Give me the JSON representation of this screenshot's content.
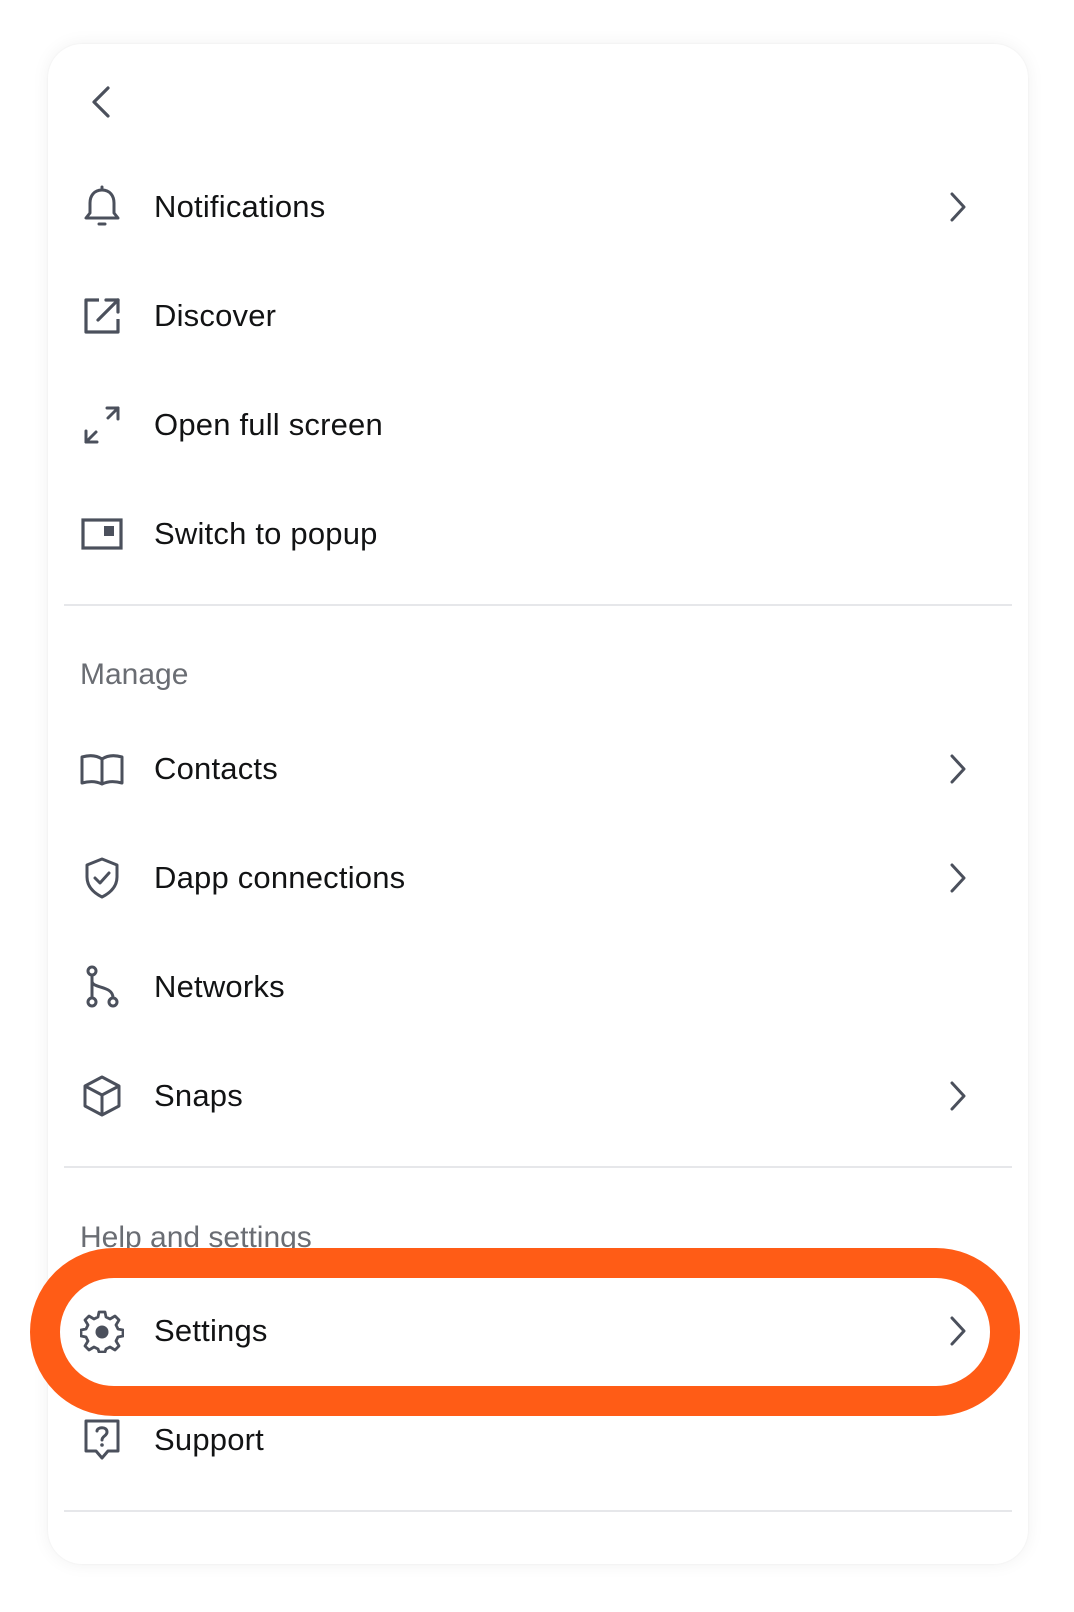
{
  "menu": {
    "back_icon": "chevron-left-icon",
    "items_top": [
      {
        "label": "Notifications",
        "icon": "bell-icon",
        "has_chevron": true
      },
      {
        "label": "Discover",
        "icon": "external-link-icon",
        "has_chevron": false
      },
      {
        "label": "Open full screen",
        "icon": "expand-icon",
        "has_chevron": false
      },
      {
        "label": "Switch to popup",
        "icon": "popup-icon",
        "has_chevron": false
      }
    ],
    "manage": {
      "title": "Manage",
      "items": [
        {
          "label": "Contacts",
          "icon": "book-icon",
          "has_chevron": true
        },
        {
          "label": "Dapp connections",
          "icon": "shield-check-icon",
          "has_chevron": true
        },
        {
          "label": "Networks",
          "icon": "network-icon",
          "has_chevron": false
        },
        {
          "label": "Snaps",
          "icon": "cube-icon",
          "has_chevron": true
        }
      ]
    },
    "help": {
      "title": "Help and settings",
      "items": [
        {
          "label": "Settings",
          "icon": "gear-icon",
          "has_chevron": true
        },
        {
          "label": "Support",
          "icon": "question-icon",
          "has_chevron": false
        }
      ]
    }
  },
  "colors": {
    "text": "#121314",
    "muted": "#6a6d73",
    "icon": "#4b505c",
    "divider": "#e6e7ea",
    "highlight": "#ff5c16"
  }
}
